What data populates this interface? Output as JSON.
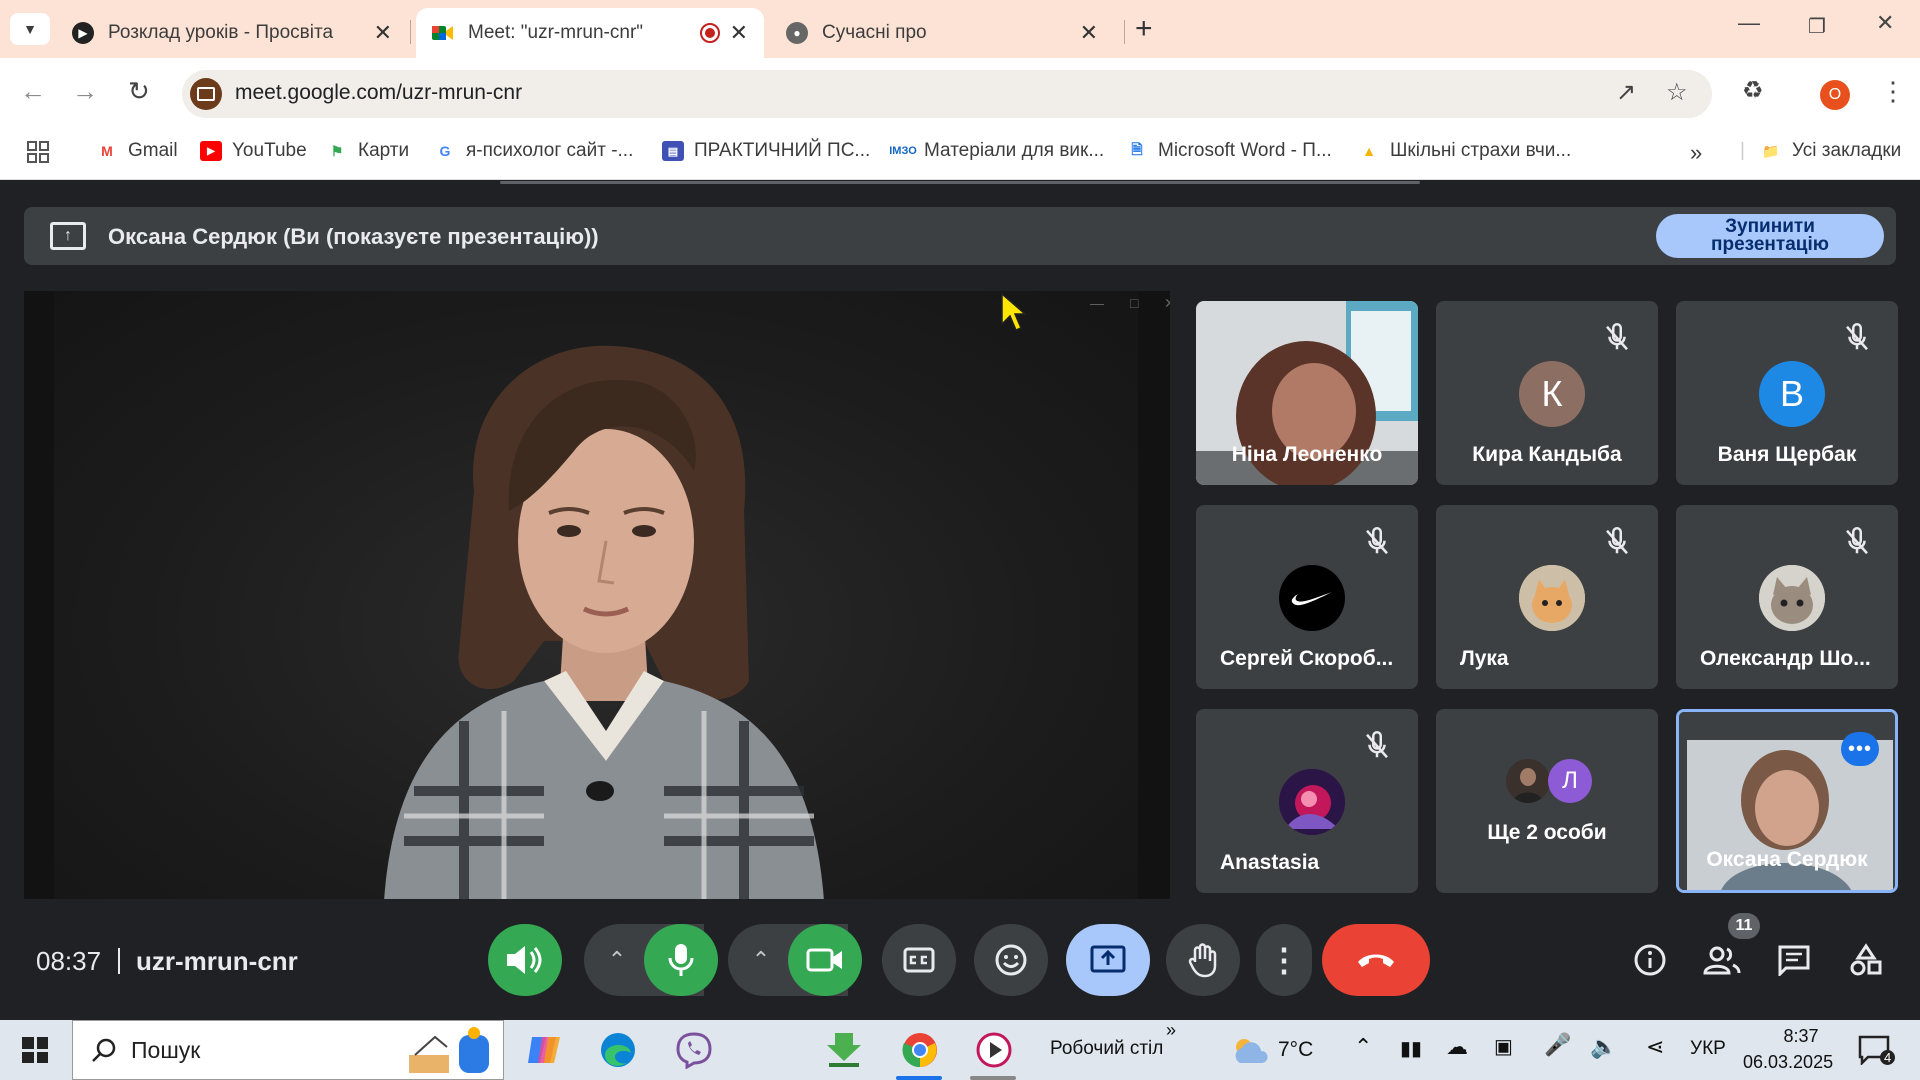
{
  "browser": {
    "tabs": [
      {
        "title": "Розклад уроків - Просвіта"
      },
      {
        "title": "Meet: \"uzr-mrun-cnr\""
      },
      {
        "title": "Сучасні про"
      }
    ],
    "url": "meet.google.com/uzr-mrun-cnr",
    "profile_initial": "O",
    "bookmarks": [
      {
        "label": "Gmail"
      },
      {
        "label": "YouTube"
      },
      {
        "label": "Карти"
      },
      {
        "label": "я-психолог сайт -..."
      },
      {
        "label": "ПРАКТИЧНИЙ ПС..."
      },
      {
        "label": "Матеріали для вик..."
      },
      {
        "label": "Microsoft Word - П..."
      },
      {
        "label": "Шкільні страхи вчи..."
      }
    ],
    "all_bookmarks": "Усі закладки"
  },
  "meet": {
    "banner_text": "Оксана Сердюк (Ви (показуєте презентацію))",
    "stop_label_line1": "Зупинити",
    "stop_label_line2": "презентацію",
    "participants": [
      {
        "name": "Ніна Леоненко"
      },
      {
        "name": "Кира Кандыба",
        "initial": "К",
        "color": "#8d6e63"
      },
      {
        "name": "Ваня Щербак",
        "initial": "В",
        "color": "#1e88e5"
      },
      {
        "name": "Сергей Скороб..."
      },
      {
        "name": "Лука"
      },
      {
        "name": "Олександр Шо..."
      },
      {
        "name": "Anastasia"
      },
      {
        "name": "Ще 2 особи",
        "initial": "Л",
        "color": "#8e5bd6"
      },
      {
        "name": "Оксана Сердюк"
      }
    ],
    "time": "08:37",
    "meeting_code": "uzr-mrun-cnr",
    "participant_count": "11"
  },
  "taskbar": {
    "search_placeholder": "Пошук",
    "desktop_label": "Робочий стіл",
    "temperature": "7°C",
    "language": "УКР",
    "clock_time": "8:37",
    "clock_date": "06.03.2025",
    "notification_count": "4"
  }
}
